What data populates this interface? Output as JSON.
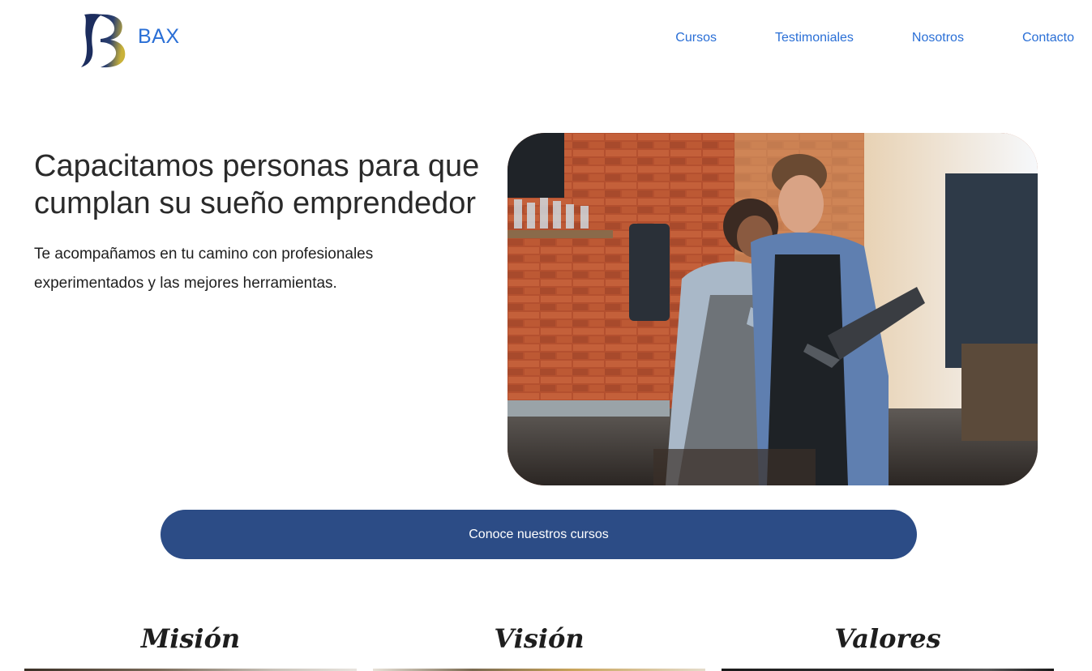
{
  "header": {
    "brand": "BAX",
    "nav": [
      "Cursos",
      "Testimoniales",
      "Nosotros",
      "Contacto"
    ]
  },
  "hero": {
    "title": "Capacitamos personas para que cumplan su sueño emprendedor",
    "subtitle": "Te acompañamos en tu camino con profesionales experimentados y las mejores herramientas.",
    "cta": "Conoce nuestros cursos"
  },
  "sections": [
    "Misión",
    "Visión",
    "Valores"
  ],
  "colors": {
    "accent": "#2a6fd6",
    "button": "#2c4c86",
    "logo_navy": "#1c2d5e",
    "logo_gold": "#c9b23a"
  },
  "icons": {
    "logo": "bax-b-logo"
  }
}
